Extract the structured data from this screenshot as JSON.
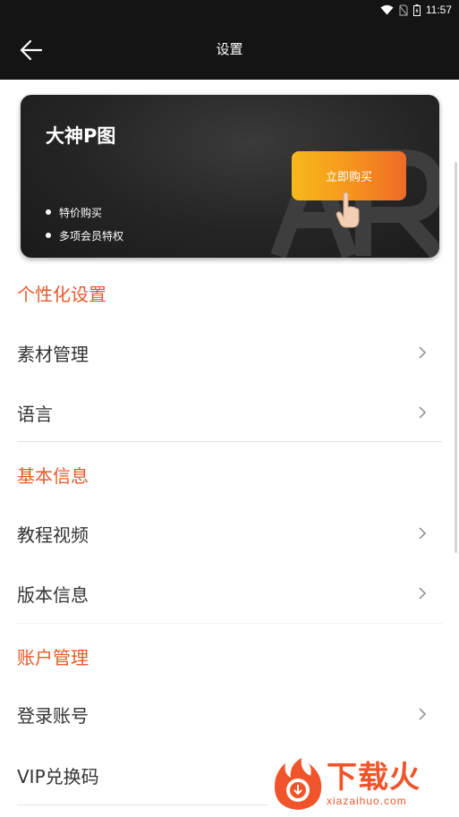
{
  "status_bar": {
    "time": "11:57"
  },
  "header": {
    "title": "设置"
  },
  "promo": {
    "brand": "大神P图",
    "features": [
      "特价购买",
      "多项会员特权"
    ],
    "buy_label": "立即购买"
  },
  "sections": {
    "personalization": {
      "title": "个性化设置",
      "items": [
        {
          "label": "素材管理"
        },
        {
          "label": "语言"
        }
      ]
    },
    "basic_info": {
      "title": "基本信息",
      "items": [
        {
          "label": "教程视频"
        },
        {
          "label": "版本信息"
        }
      ]
    },
    "account": {
      "title": "账户管理",
      "items": [
        {
          "label": "登录账号"
        },
        {
          "label": "VIP兑换码"
        }
      ]
    }
  },
  "watermark": {
    "name": "下载火",
    "domain": "xiazaihuo.com"
  },
  "colors": {
    "accent": "#e55a2b",
    "header_bg": "#141414",
    "buy_start": "#f6b91c",
    "buy_end": "#ee6b27"
  }
}
